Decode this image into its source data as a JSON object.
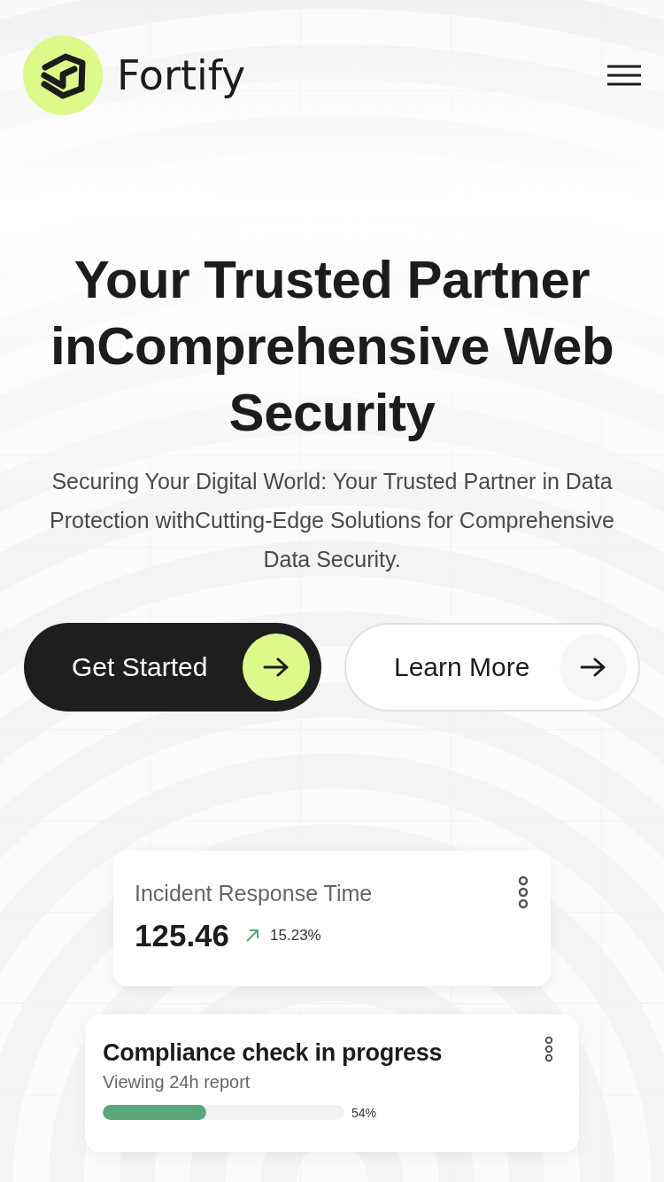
{
  "header": {
    "brand": "Fortify"
  },
  "hero": {
    "title_lines": [
      "Your Trusted Partner",
      "inComprehensive Web",
      "Security"
    ],
    "subtitle": "Securing Your Digital World: Your Trusted Partner in Data Protection withCutting-Edge Solutions for Comprehensive Data Security."
  },
  "buttons": [
    {
      "kind": "primary",
      "label": "Get Started"
    },
    {
      "kind": "secondary",
      "label": "Learn More"
    }
  ],
  "metric_card": {
    "title": "Incident Response Time",
    "value": "125.46",
    "change": "15.23%"
  },
  "progress_card": {
    "title": "Compliance check in progress",
    "subtitle": "Viewing 24h report",
    "level": 0.43,
    "reading": "54%"
  }
}
